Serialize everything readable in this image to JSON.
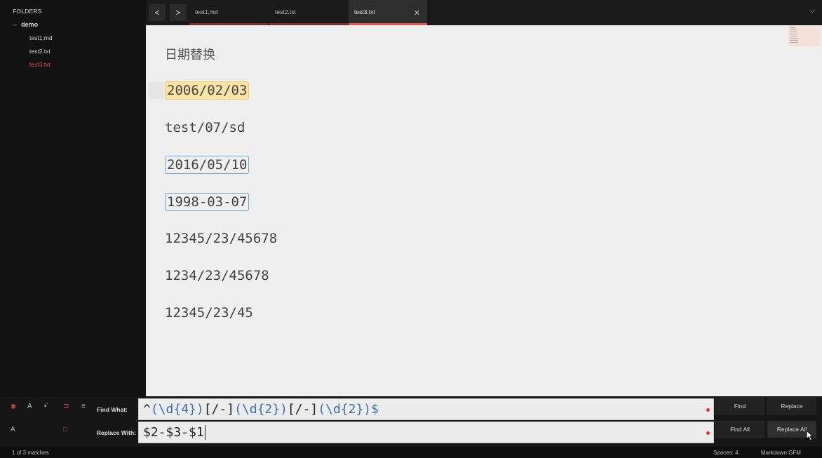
{
  "sidebar": {
    "header": "FOLDERS",
    "folder": "demo",
    "files": [
      {
        "name": "test1.md",
        "active": false
      },
      {
        "name": "test2.txt",
        "active": false
      },
      {
        "name": "test3.txt",
        "active": true
      }
    ]
  },
  "tabs": [
    {
      "label": "test1.md",
      "active": false
    },
    {
      "label": "test2.txt",
      "active": false
    },
    {
      "label": "test3.txt",
      "active": true
    }
  ],
  "nav": {
    "back": "<",
    "forward": ">"
  },
  "editor": {
    "lines": [
      "日期替换",
      "2006/02/03",
      "test/07/sd",
      "2016/05/10",
      "1998-03-07",
      "12345/23/45678",
      "1234/23/45678",
      "12345/23/45"
    ]
  },
  "find": {
    "find_label": "Find What:",
    "replace_label": "Replace With:",
    "find_value_parts": [
      "^",
      "(\\d{4})",
      "[/-]",
      "(\\d{2})",
      "[/-]",
      "(\\d{2})",
      "$"
    ],
    "replace_value": "$2-$3-$1",
    "buttons": {
      "find": "Find",
      "replace": "Replace",
      "find_all": "Find All",
      "replace_all": "Replace All"
    }
  },
  "status": {
    "matches": "1 of 3 matches",
    "spaces": "Spaces: 4",
    "syntax": "Markdown GFM"
  },
  "colors": {
    "accent": "#e0453a",
    "match_border": "#5fa9e6",
    "current_match_bg": "#fbe3a6",
    "regex_token": "#3b6fb0"
  }
}
